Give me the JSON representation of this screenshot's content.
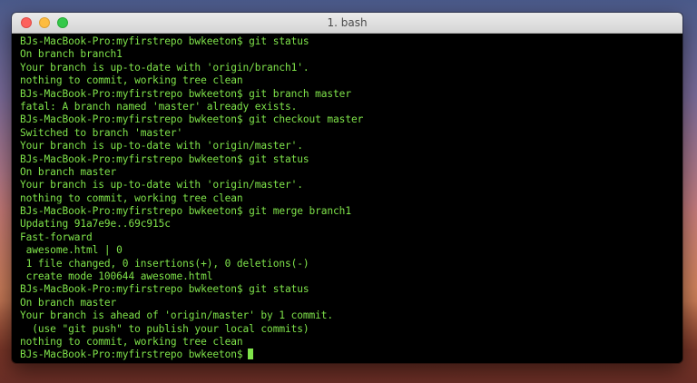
{
  "window": {
    "title": "1. bash"
  },
  "terminal": {
    "lines": [
      "BJs-MacBook-Pro:myfirstrepo bwkeeton$ git status",
      "On branch branch1",
      "Your branch is up-to-date with 'origin/branch1'.",
      "nothing to commit, working tree clean",
      "BJs-MacBook-Pro:myfirstrepo bwkeeton$ git branch master",
      "fatal: A branch named 'master' already exists.",
      "BJs-MacBook-Pro:myfirstrepo bwkeeton$ git checkout master",
      "Switched to branch 'master'",
      "Your branch is up-to-date with 'origin/master'.",
      "BJs-MacBook-Pro:myfirstrepo bwkeeton$ git status",
      "On branch master",
      "Your branch is up-to-date with 'origin/master'.",
      "nothing to commit, working tree clean",
      "BJs-MacBook-Pro:myfirstrepo bwkeeton$ git merge branch1",
      "Updating 91a7e9e..69c915c",
      "Fast-forward",
      " awesome.html | 0",
      " 1 file changed, 0 insertions(+), 0 deletions(-)",
      " create mode 100644 awesome.html",
      "BJs-MacBook-Pro:myfirstrepo bwkeeton$ git status",
      "On branch master",
      "Your branch is ahead of 'origin/master' by 1 commit.",
      "  (use \"git push\" to publish your local commits)",
      "nothing to commit, working tree clean",
      "BJs-MacBook-Pro:myfirstrepo bwkeeton$"
    ]
  },
  "colors": {
    "terminal_text": "#7fe34a",
    "terminal_background": "#000000",
    "close": "#fc605c",
    "minimize": "#fdbc40",
    "zoom": "#34c84a"
  }
}
